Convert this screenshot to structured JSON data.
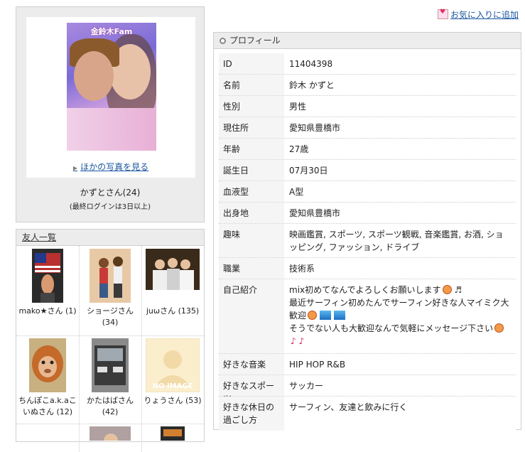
{
  "favorite_link": "お気に入りに追加",
  "card": {
    "photo_stamp": "金鈴木Fam",
    "more_photos": "ほかの写真を見る",
    "name": "かずとさん(24)",
    "login": "(最終ログインは3日以上)"
  },
  "friends": {
    "header": "友人一覧",
    "items": [
      {
        "name": "mako★さん (1)"
      },
      {
        "name": "ショージさん (34)"
      },
      {
        "name": "juωさん (135)"
      },
      {
        "name": "ちんぽこa.k.aこいぬさん (12)"
      },
      {
        "name": "かたはばさん (42)"
      },
      {
        "name": "りょうさん (53)"
      }
    ],
    "no_image": "NO IMAGE"
  },
  "profile": {
    "header": "プロフィール",
    "rows": [
      {
        "k": "ID",
        "v": "11404398"
      },
      {
        "k": "名前",
        "v": "鈴木 かずと"
      },
      {
        "k": "性別",
        "v": "男性"
      },
      {
        "k": "現住所",
        "v": "愛知県豊橋市"
      },
      {
        "k": "年齢",
        "v": "27歳"
      },
      {
        "k": "誕生日",
        "v": "07月30日"
      },
      {
        "k": "血液型",
        "v": "A型"
      },
      {
        "k": "出身地",
        "v": "愛知県豊橋市"
      },
      {
        "k": "趣味",
        "v": "映画鑑賞, スポーツ, スポーツ観戦, 音楽鑑賞, お酒, ショッピング, ファッション, ドライブ"
      },
      {
        "k": "職業",
        "v": "技術系"
      },
      {
        "k": "自己紹介",
        "v1": "mix初めてなんでよろしくお願いします",
        "v2": "最近サーフィン初めたんでサーフィン好きな人マイミク大歓迎",
        "v3": "そうでない人も大歓迎なんで気軽にメッセージ下さい"
      },
      {
        "k": "好きな音楽",
        "v": "HIP HOP R&B"
      },
      {
        "k": "好きなスポーツ",
        "v": "サッカー"
      },
      {
        "k": "好きな休日の過ごし方",
        "v": "サーフィン、友達と飲みに行く"
      }
    ]
  }
}
